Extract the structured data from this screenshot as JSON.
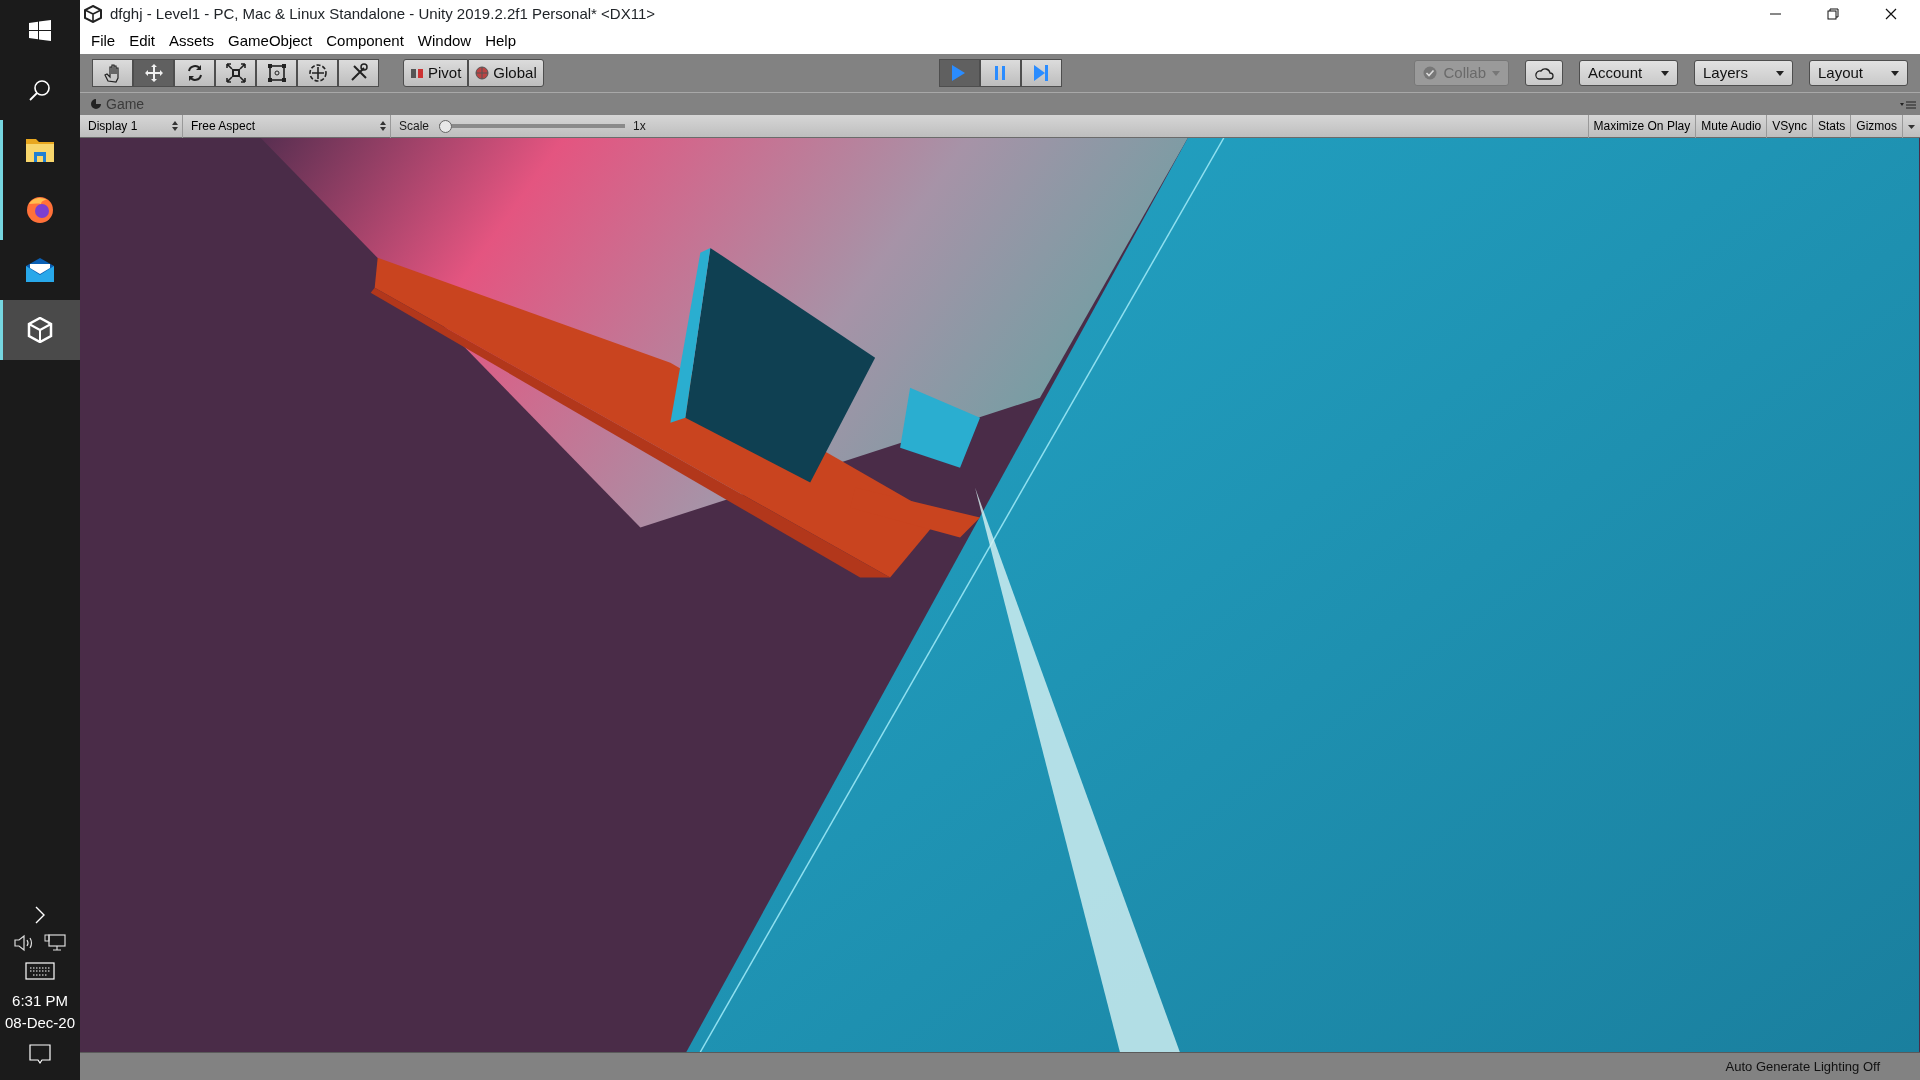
{
  "taskbar": {
    "items": [
      {
        "kind": "windows",
        "running": false,
        "selected": false
      },
      {
        "kind": "search",
        "running": false,
        "selected": false
      },
      {
        "kind": "folder",
        "running": true,
        "selected": false
      },
      {
        "kind": "firefox",
        "running": true,
        "selected": false
      },
      {
        "kind": "mail",
        "running": false,
        "selected": false
      },
      {
        "kind": "unity",
        "running": true,
        "selected": true
      }
    ],
    "tray": {
      "time": "6:31 PM",
      "date": "08-Dec-20"
    }
  },
  "window": {
    "title": "dfghj - Level1 - PC, Mac & Linux Standalone - Unity 2019.2.2f1 Personal* <DX11>"
  },
  "menu": [
    "File",
    "Edit",
    "Assets",
    "GameObject",
    "Component",
    "Window",
    "Help"
  ],
  "toolbar": {
    "tools": [
      {
        "kind": "hand",
        "selected": false
      },
      {
        "kind": "move",
        "selected": true
      },
      {
        "kind": "rotate",
        "selected": false
      },
      {
        "kind": "scale",
        "selected": false
      },
      {
        "kind": "rect",
        "selected": false
      },
      {
        "kind": "transform",
        "selected": false
      },
      {
        "kind": "custom",
        "selected": false
      }
    ],
    "pivot": "Pivot",
    "global": "Global",
    "playback": [
      {
        "kind": "play",
        "selected": true
      },
      {
        "kind": "pause",
        "selected": false
      },
      {
        "kind": "step",
        "selected": false
      }
    ],
    "collab": {
      "label": "Collab",
      "disabled": true
    },
    "dropdowns": [
      "Account",
      "Layers",
      "Layout"
    ]
  },
  "game": {
    "tab": "Game",
    "display": "Display 1",
    "aspect": "Free Aspect",
    "scale_label": "Scale",
    "scale": {
      "level": 0,
      "reading": "1x"
    },
    "toggles": [
      {
        "label": "Maximize On Play",
        "selected": false
      },
      {
        "label": "Mute Audio",
        "selected": false
      },
      {
        "label": "VSync",
        "selected": false
      },
      {
        "label": "Stats",
        "selected": false
      },
      {
        "label": "Gizmos",
        "selected": false
      }
    ]
  },
  "status_bar": "Auto Generate Lighting Off"
}
